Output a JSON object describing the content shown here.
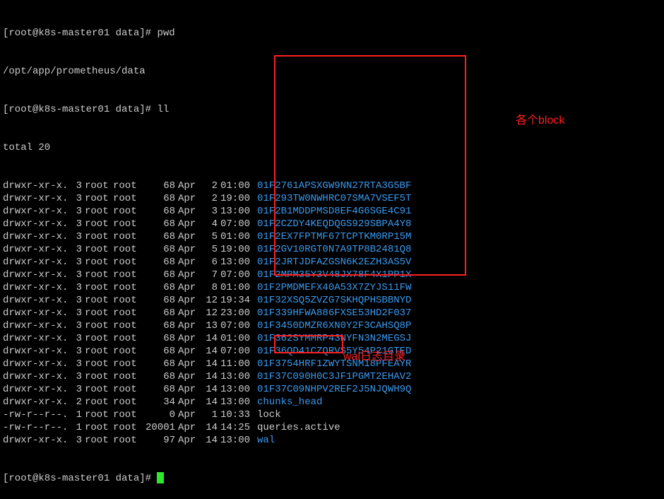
{
  "prompt_host": "[root@k8s-master01 data]# ",
  "cmd_pwd": "pwd",
  "pwd_output": "/opt/app/prometheus/data",
  "cmd_ll": "ll",
  "total_line": "total 20",
  "annotations": {
    "block_label": "各个block",
    "wal_label": "wal日志目录"
  },
  "entries": [
    {
      "perms": "drwxr-xr-x.",
      "links": "3",
      "owner": "root",
      "group": "root",
      "size": "68",
      "month": "Apr",
      "day": "2",
      "time": "01:00",
      "name": "01F2761APSXGW9NN27RTA3G5BF",
      "color": "blue"
    },
    {
      "perms": "drwxr-xr-x.",
      "links": "3",
      "owner": "root",
      "group": "root",
      "size": "68",
      "month": "Apr",
      "day": "2",
      "time": "19:00",
      "name": "01F293TW0NWHRC07SMA7VSEF5T",
      "color": "blue"
    },
    {
      "perms": "drwxr-xr-x.",
      "links": "3",
      "owner": "root",
      "group": "root",
      "size": "68",
      "month": "Apr",
      "day": "3",
      "time": "13:00",
      "name": "01F2B1MDDPMSD8EF4G6SGE4C91",
      "color": "blue"
    },
    {
      "perms": "drwxr-xr-x.",
      "links": "3",
      "owner": "root",
      "group": "root",
      "size": "68",
      "month": "Apr",
      "day": "4",
      "time": "07:00",
      "name": "01F2CZDY4KEQDQGS929SBPA4Y8",
      "color": "blue"
    },
    {
      "perms": "drwxr-xr-x.",
      "links": "3",
      "owner": "root",
      "group": "root",
      "size": "68",
      "month": "Apr",
      "day": "5",
      "time": "01:00",
      "name": "01F2EX7FPTMF67TCPTKM0RP15M",
      "color": "blue"
    },
    {
      "perms": "drwxr-xr-x.",
      "links": "3",
      "owner": "root",
      "group": "root",
      "size": "68",
      "month": "Apr",
      "day": "5",
      "time": "19:00",
      "name": "01F2GV10RGT0N7A9TP8B2481Q8",
      "color": "blue"
    },
    {
      "perms": "drwxr-xr-x.",
      "links": "3",
      "owner": "root",
      "group": "root",
      "size": "68",
      "month": "Apr",
      "day": "6",
      "time": "13:00",
      "name": "01F2JRTJDFAZGSN6K2EZH3AS5V",
      "color": "blue"
    },
    {
      "perms": "drwxr-xr-x.",
      "links": "3",
      "owner": "root",
      "group": "root",
      "size": "68",
      "month": "Apr",
      "day": "7",
      "time": "07:00",
      "name": "01F2MPM35Y3V48JX78F4X1PP1X",
      "color": "blue"
    },
    {
      "perms": "drwxr-xr-x.",
      "links": "3",
      "owner": "root",
      "group": "root",
      "size": "68",
      "month": "Apr",
      "day": "8",
      "time": "01:00",
      "name": "01F2PMDMEFX40A53X7ZYJS11FW",
      "color": "blue"
    },
    {
      "perms": "drwxr-xr-x.",
      "links": "3",
      "owner": "root",
      "group": "root",
      "size": "68",
      "month": "Apr",
      "day": "12",
      "time": "19:34",
      "name": "01F32XSQ5ZVZG7SKHQPHSBBNYD",
      "color": "blue"
    },
    {
      "perms": "drwxr-xr-x.",
      "links": "3",
      "owner": "root",
      "group": "root",
      "size": "68",
      "month": "Apr",
      "day": "12",
      "time": "23:00",
      "name": "01F339HFWA886FXSE53HD2F037",
      "color": "blue"
    },
    {
      "perms": "drwxr-xr-x.",
      "links": "3",
      "owner": "root",
      "group": "root",
      "size": "68",
      "month": "Apr",
      "day": "13",
      "time": "07:00",
      "name": "01F3450DMZR6XN0Y2F3CAHSQ8P",
      "color": "blue"
    },
    {
      "perms": "drwxr-xr-x.",
      "links": "3",
      "owner": "root",
      "group": "root",
      "size": "68",
      "month": "Apr",
      "day": "14",
      "time": "01:00",
      "name": "01F362SYMMRP43NYFN3N2MEGSJ",
      "color": "blue"
    },
    {
      "perms": "drwxr-xr-x.",
      "links": "3",
      "owner": "root",
      "group": "root",
      "size": "68",
      "month": "Apr",
      "day": "14",
      "time": "07:00",
      "name": "01F36QD41CZQRVS5Y54P21GTED",
      "color": "blue"
    },
    {
      "perms": "drwxr-xr-x.",
      "links": "3",
      "owner": "root",
      "group": "root",
      "size": "68",
      "month": "Apr",
      "day": "14",
      "time": "11:00",
      "name": "01F3754HRF1ZWYTSNM18PFEAYR",
      "color": "blue"
    },
    {
      "perms": "drwxr-xr-x.",
      "links": "3",
      "owner": "root",
      "group": "root",
      "size": "68",
      "month": "Apr",
      "day": "14",
      "time": "13:00",
      "name": "01F37C090H0C3JF1PGMT2EHAV2",
      "color": "blue"
    },
    {
      "perms": "drwxr-xr-x.",
      "links": "3",
      "owner": "root",
      "group": "root",
      "size": "68",
      "month": "Apr",
      "day": "14",
      "time": "13:00",
      "name": "01F37C09NHPV2REF2J5NJQWH9Q",
      "color": "blue"
    },
    {
      "perms": "drwxr-xr-x.",
      "links": "2",
      "owner": "root",
      "group": "root",
      "size": "34",
      "month": "Apr",
      "day": "14",
      "time": "13:00",
      "name": "chunks_head",
      "color": "blue"
    },
    {
      "perms": "-rw-r--r--.",
      "links": "1",
      "owner": "root",
      "group": "root",
      "size": "0",
      "month": "Apr",
      "day": "1",
      "time": "10:33",
      "name": "lock",
      "color": "white"
    },
    {
      "perms": "-rw-r--r--.",
      "links": "1",
      "owner": "root",
      "group": "root",
      "size": "20001",
      "month": "Apr",
      "day": "14",
      "time": "14:25",
      "name": "queries.active",
      "color": "white"
    },
    {
      "perms": "drwxr-xr-x.",
      "links": "3",
      "owner": "root",
      "group": "root",
      "size": "97",
      "month": "Apr",
      "day": "14",
      "time": "13:00",
      "name": "wal",
      "color": "blue"
    }
  ]
}
